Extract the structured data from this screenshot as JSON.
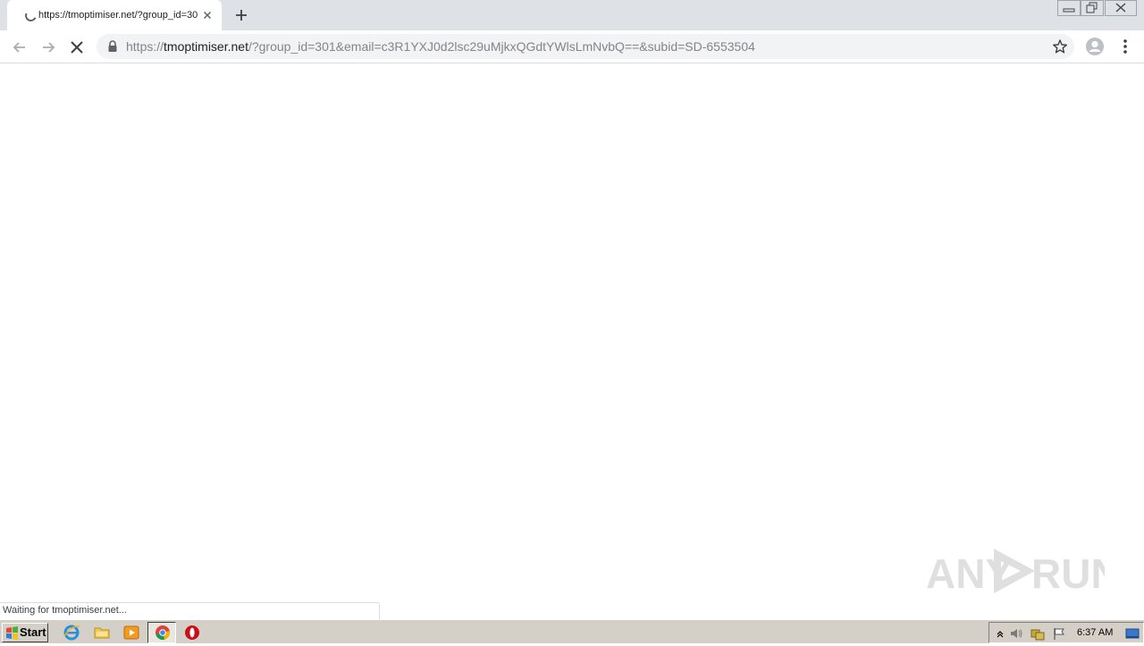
{
  "browser": {
    "tab": {
      "title": "https://tmoptimiser.net/?group_id=301&email=c3R1YXJ0d2lsc29uMjkxQGdtYWlsLmNvbQ==&subid=SD-6553504",
      "state": "loading"
    },
    "address_bar": {
      "scheme": "https://",
      "host": "tmoptimiser.net",
      "path": "/?group_id=301&email=c3R1YXJ0d2lsc29uMjkxQGdtYWlsLmNvbQ==&subid=SD-6553504",
      "secure": true
    },
    "status_text": "Waiting for tmoptimiser.net..."
  },
  "watermark": {
    "text_left": "ANY",
    "text_right": "RUN"
  },
  "taskbar": {
    "start_label": "Start",
    "pinned_icons": [
      "internet-explorer-icon",
      "folder-icon",
      "media-player-icon",
      "chrome-icon",
      "opera-icon"
    ],
    "active_app": "chrome-icon",
    "tray_icons": [
      "show-hidden-icons-arrow",
      "volume-icon",
      "network-icon",
      "action-center-flag-icon",
      "show-desktop-icon"
    ],
    "clock": "6:37 AM"
  },
  "colors": {
    "tabstrip_bg": "#dee1e6",
    "omnibox_bg": "#f1f3f4",
    "taskbar_bg": "#d4d0c8",
    "opera_red": "#cc0f16"
  }
}
